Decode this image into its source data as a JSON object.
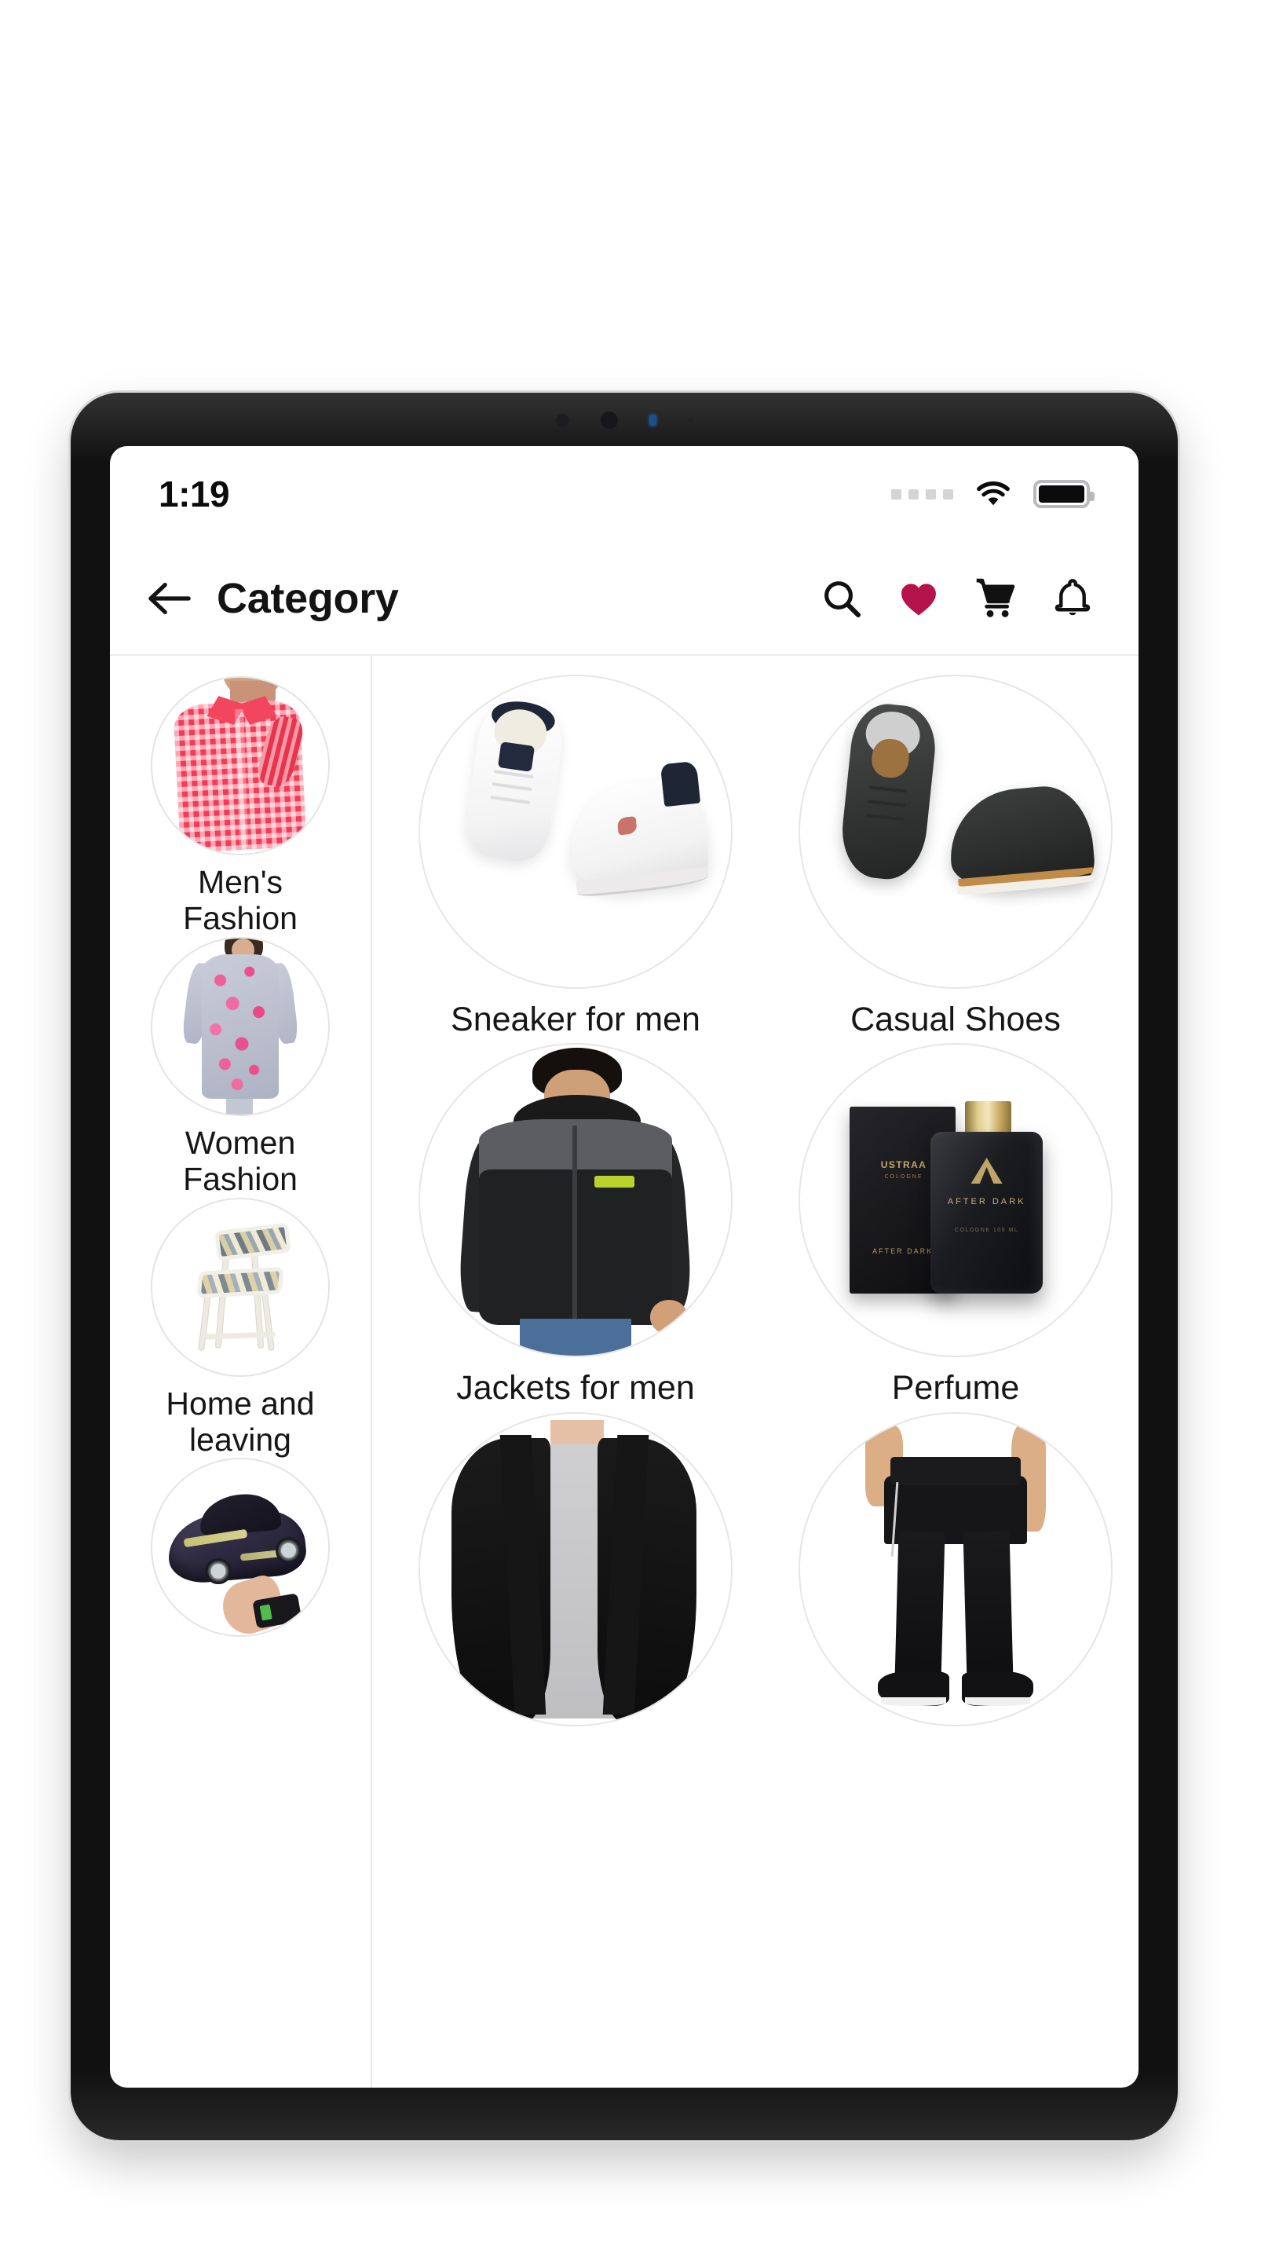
{
  "status_bar": {
    "time": "1:19",
    "signal_dots": 4,
    "wifi_icon": "wifi-icon",
    "battery_icon": "battery-full-icon"
  },
  "app_bar": {
    "back_icon": "arrow-left-icon",
    "title": "Category",
    "actions": [
      {
        "name": "search-icon",
        "label": "Search"
      },
      {
        "name": "heart-icon",
        "label": "Wishlist"
      },
      {
        "name": "cart-icon",
        "label": "Cart"
      },
      {
        "name": "bell-icon",
        "label": "Notifications"
      }
    ]
  },
  "sidebar": {
    "items": [
      {
        "label": "Men's Fashion",
        "image": "checkered-pink-shirt"
      },
      {
        "label": "Women Fashion",
        "image": "floral-kurti"
      },
      {
        "label": "Home and leaving",
        "image": "folding-chair"
      },
      {
        "label": "",
        "image": "remote-control-toy-car"
      }
    ]
  },
  "grid": {
    "items": [
      {
        "label": "Sneaker for men",
        "image": "white-sneakers"
      },
      {
        "label": "Casual Shoes",
        "image": "dark-casual-shoes"
      },
      {
        "label": "Jackets for men",
        "image": "man-in-black-grey-hooded-jacket"
      },
      {
        "label": "Perfume",
        "image": "ustraa-after-dark-cologne"
      },
      {
        "label": "",
        "image": "black-open-front-cardigan"
      },
      {
        "label": "",
        "image": "black-track-pants"
      }
    ]
  },
  "colors": {
    "accent_heart": "#B5134B",
    "text_primary": "#161616",
    "divider": "#E9E9E9",
    "device_frame": "#111112",
    "screen_bg": "#FFFFFF"
  },
  "perfume_art": {
    "brand": "USTRAA",
    "brand_sub": "COLOGNE",
    "variant": "AFTER DARK",
    "box_bottom": "AFTER DARK",
    "size": "COLOGNE\n100 ML"
  }
}
